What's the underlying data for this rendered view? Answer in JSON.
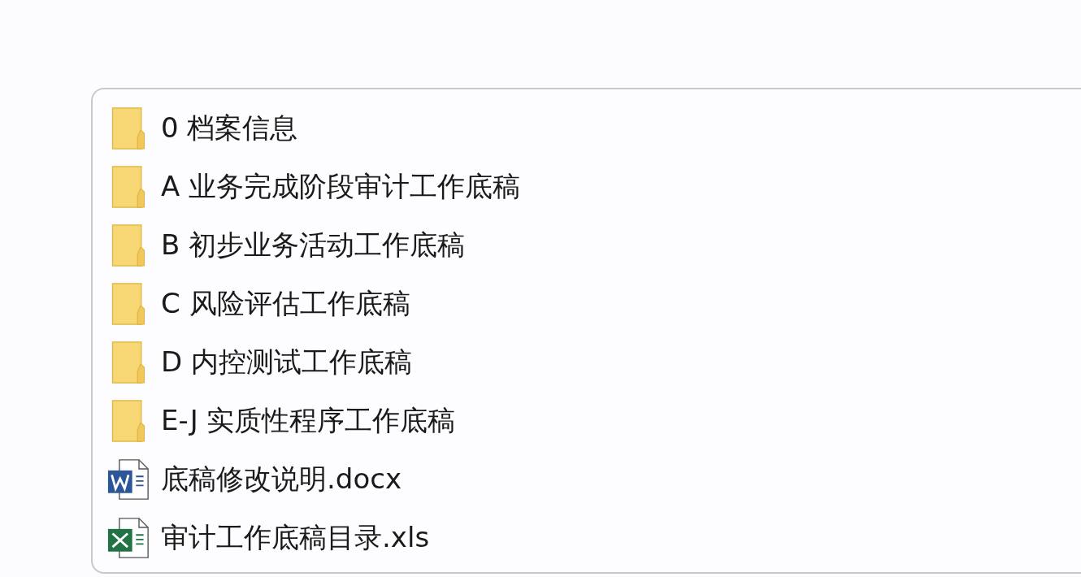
{
  "files": [
    {
      "kind": "folder",
      "name": "0 档案信息"
    },
    {
      "kind": "folder",
      "name": "A 业务完成阶段审计工作底稿"
    },
    {
      "kind": "folder",
      "name": "B 初步业务活动工作底稿"
    },
    {
      "kind": "folder",
      "name": "C 风险评估工作底稿"
    },
    {
      "kind": "folder",
      "name": "D 内控测试工作底稿"
    },
    {
      "kind": "folder",
      "name": "E-J 实质性程序工作底稿"
    },
    {
      "kind": "word",
      "name": "底稿修改说明.docx"
    },
    {
      "kind": "excel",
      "name": "审计工作底稿目录.xls"
    }
  ]
}
